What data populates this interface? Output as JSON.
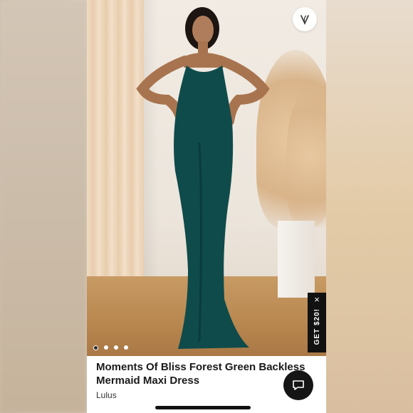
{
  "product": {
    "title": "Moments Of Bliss Forest Green Backless Mermaid Maxi Dress",
    "brand": "Lulus"
  },
  "gallery": {
    "total_images": 4,
    "active_index": 0
  },
  "promo": {
    "label": "GET $20!",
    "close_glyph": "×"
  },
  "icons": {
    "favorite": "heart-icon",
    "chat": "chat-bubble-icon"
  },
  "colors": {
    "dress": "#0f4b4b",
    "promo_bg": "#111111",
    "chat_bg": "#151515"
  }
}
